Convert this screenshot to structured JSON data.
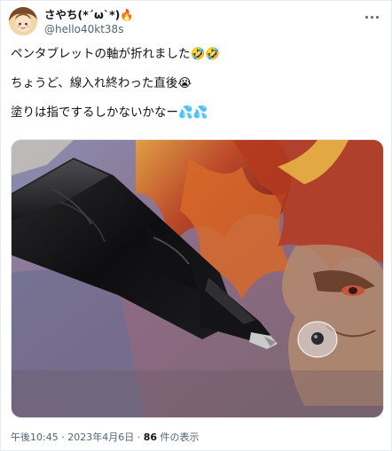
{
  "author": {
    "display_name": "さやち(*´ω`*)🔥",
    "handle": "@hello40kt38s"
  },
  "tweet": {
    "lines": [
      "ペンタブレットの軸が折れました🤣🤣",
      "ちょうど、線入れ終わった直後😭",
      "塗りは指でするしかないかなー💦💦"
    ]
  },
  "meta": {
    "time": "午後10:45",
    "separator": " · ",
    "date": "2023年4月6日",
    "views_count": "86",
    "views_label": "件の表示"
  },
  "colors": {
    "text_primary": "#0f1419",
    "text_secondary": "#536471",
    "border": "#e6ebee"
  },
  "icons": {
    "more": "more-horizontal-icon"
  }
}
